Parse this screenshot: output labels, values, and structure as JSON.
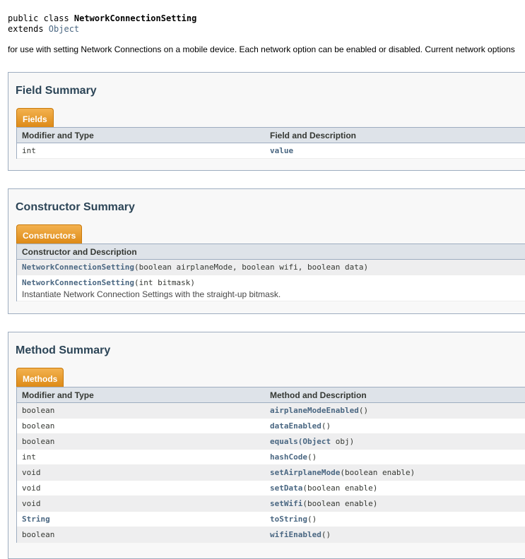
{
  "signature": {
    "prefix": "public class ",
    "class_name": "NetworkConnectionSetting",
    "extends_label": "extends ",
    "parent": "Object"
  },
  "description": "for use with setting Network Connections on a mobile device. Each network option can be enabled or disabled. Current network options",
  "field_summary": {
    "title": "Field Summary",
    "tab": "Fields",
    "col1": "Modifier and Type",
    "col2": "Field and Description",
    "rows": [
      {
        "type": "int",
        "name": "value",
        "params": ""
      }
    ]
  },
  "constructor_summary": {
    "title": "Constructor Summary",
    "tab": "Constructors",
    "col1": "Constructor and Description",
    "rows": [
      {
        "name": "NetworkConnectionSetting",
        "params": "(boolean airplaneMode, boolean wifi, boolean data)",
        "desc": ""
      },
      {
        "name": "NetworkConnectionSetting",
        "params": "(int bitmask)",
        "desc": "Instantiate Network Connection Settings with the straight-up bitmask."
      }
    ]
  },
  "method_summary": {
    "title": "Method Summary",
    "tab": "Methods",
    "col1": "Modifier and Type",
    "col2": "Method and Description",
    "rows": [
      {
        "type": "boolean",
        "name": "airplaneModeEnabled",
        "params": "()"
      },
      {
        "type": "boolean",
        "name": "dataEnabled",
        "params": "()"
      },
      {
        "type": "boolean",
        "name": "equals",
        "params_link": "(Object",
        "params": " obj)"
      },
      {
        "type": "int",
        "name": "hashCode",
        "params": "()"
      },
      {
        "type": "void",
        "name": "setAirplaneMode",
        "params": "(boolean enable)"
      },
      {
        "type": "void",
        "name": "setData",
        "params": "(boolean enable)"
      },
      {
        "type": "void",
        "name": "setWifi",
        "params": "(boolean enable)"
      },
      {
        "type": "String",
        "name": "toString",
        "params": "()"
      },
      {
        "type": "boolean",
        "name": "wifiEnabled",
        "params": "()"
      }
    ]
  }
}
